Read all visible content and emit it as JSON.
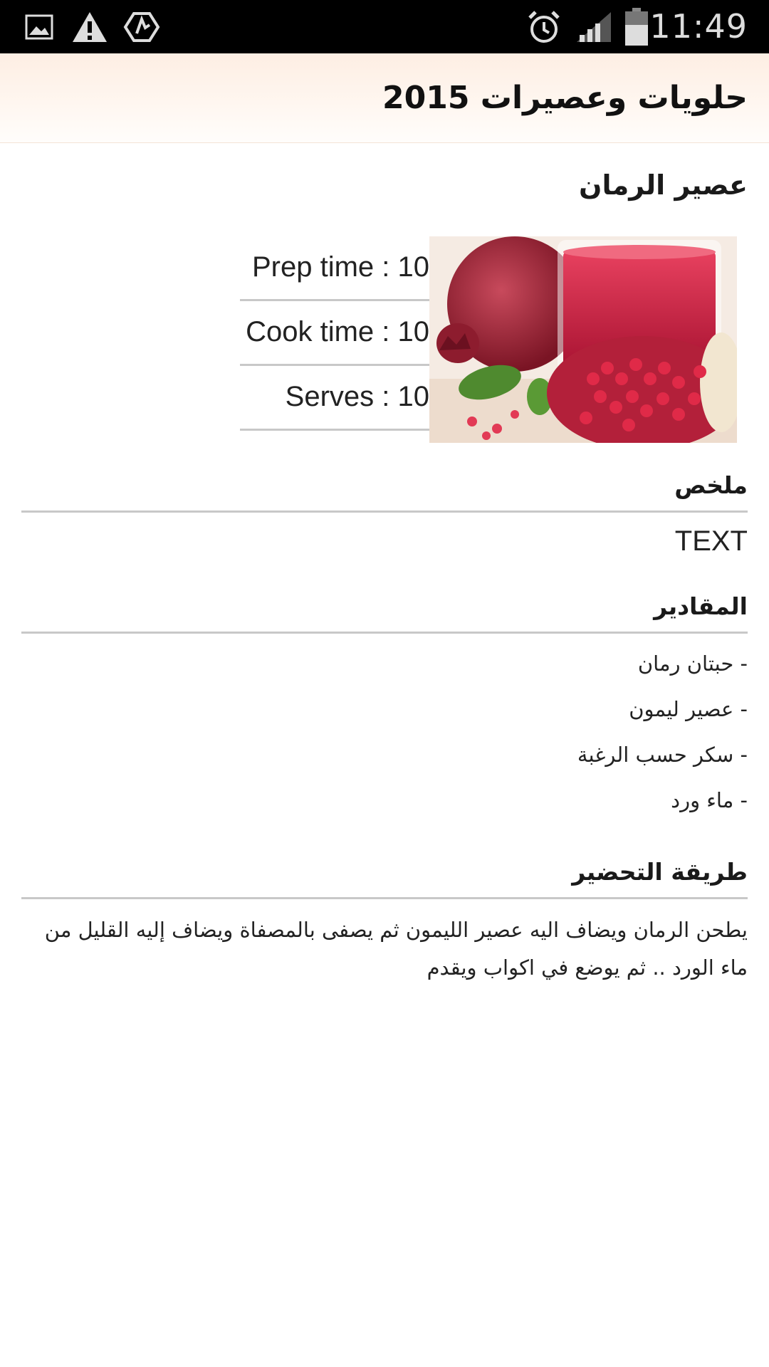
{
  "status_bar": {
    "time": "11:49",
    "icons": [
      "picture-icon",
      "warning-icon",
      "app-notification-icon",
      "alarm-icon",
      "signal-icon",
      "battery-icon"
    ]
  },
  "app_bar": {
    "title": "حلويات وعصيرات 2015"
  },
  "recipe": {
    "title": "عصير الرمان",
    "image": "pomegranate-juice-photo",
    "prep_time": "Prep time : 10",
    "cook_time": "Cook time : 10",
    "serves": "Serves : 10"
  },
  "summary": {
    "heading": "ملخص",
    "text": "TEXT"
  },
  "ingredients": {
    "heading": "المقادير",
    "items": [
      "- حبتان رمان",
      "- عصير ليمون",
      "- سكر حسب الرغبة",
      "- ماء ورد"
    ]
  },
  "method": {
    "heading": "طريقة التحضير",
    "text": "يطحن الرمان ويضاف اليه عصير الليمون ثم يصفى بالمصفاة ويضاف إليه القليل من ماء الورد .. ثم يوضع في اكواب ويقدم"
  },
  "colors": {
    "status_bar_bg": "#000000",
    "action_bar_bg": "#fdeee3",
    "divider": "#c8c8c8"
  }
}
